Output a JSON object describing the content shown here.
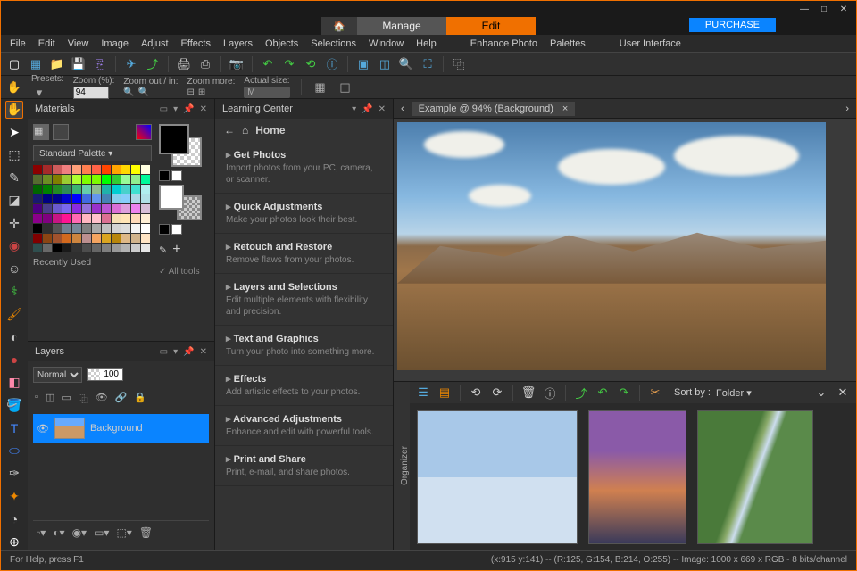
{
  "titlebar": {
    "min": "—",
    "max": "□",
    "close": "✕"
  },
  "topnav": {
    "home": "⌂",
    "manage": "Manage",
    "edit": "Edit",
    "purchase": "PURCHASE"
  },
  "menu": [
    "File",
    "Edit",
    "View",
    "Image",
    "Adjust",
    "Effects",
    "Layers",
    "Objects",
    "Selections",
    "Window",
    "Help",
    "Enhance Photo",
    "Palettes",
    "User Interface"
  ],
  "opt": {
    "presets": "Presets:",
    "zoom_lbl": "Zoom (%):",
    "zoom_val": "94",
    "zoomio": "Zoom out / in:",
    "zoommore": "Zoom more:",
    "actual": "Actual size:"
  },
  "materials": {
    "title": "Materials",
    "palette": "Standard Palette  ▾",
    "recent": "Recently Used",
    "alltools": "✓   All tools"
  },
  "layers": {
    "title": "Layers",
    "blend": "Normal",
    "opacity": "100",
    "item": "Background"
  },
  "lc": {
    "title": "Learning Center",
    "home": "Home",
    "items": [
      {
        "t": "Get Photos",
        "d": "Import photos from your PC, camera, or scanner."
      },
      {
        "t": "Quick Adjustments",
        "d": "Make your photos look their best."
      },
      {
        "t": "Retouch and Restore",
        "d": "Remove flaws from your photos."
      },
      {
        "t": "Layers and Selections",
        "d": "Edit multiple elements with flexibility and precision."
      },
      {
        "t": "Text and Graphics",
        "d": "Turn your photo into something more."
      },
      {
        "t": "Effects",
        "d": "Add artistic effects to your photos."
      },
      {
        "t": "Advanced Adjustments",
        "d": "Enhance and edit with powerful tools."
      },
      {
        "t": "Print and Share",
        "d": "Print, e-mail, and share photos."
      }
    ]
  },
  "doc": {
    "tab": "Example @  94% (Background)",
    "close": "×"
  },
  "org": {
    "label": "Organizer",
    "sortby": "Sort by :",
    "folder": "Folder  ▾"
  },
  "status": {
    "left": "For Help, press F1",
    "right": "(x:915 y:141) -- (R:125, G:154, B:214, O:255)  --  Image:   1000 x 669 x RGB  -  8 bits/channel"
  },
  "palette_colors": [
    "#8b0000",
    "#a52a2a",
    "#cd5c5c",
    "#f08080",
    "#ffa07a",
    "#ff7f50",
    "#ff6347",
    "#ff4500",
    "#ffa500",
    "#ffd700",
    "#ffff00",
    "#ffffe0",
    "#556b2f",
    "#6b8e23",
    "#808000",
    "#9acd32",
    "#adff2f",
    "#7fff00",
    "#7cfc00",
    "#00ff00",
    "#32cd32",
    "#98fb98",
    "#90ee90",
    "#00fa9a",
    "#006400",
    "#008000",
    "#228b22",
    "#2e8b57",
    "#3cb371",
    "#66cdaa",
    "#8fbc8f",
    "#20b2aa",
    "#00ced1",
    "#48d1cc",
    "#40e0d0",
    "#afeeee",
    "#191970",
    "#000080",
    "#00008b",
    "#0000cd",
    "#0000ff",
    "#4169e1",
    "#6495ed",
    "#4682b4",
    "#87ceeb",
    "#87cefa",
    "#add8e6",
    "#b0e0e6",
    "#4b0082",
    "#483d8b",
    "#6a5acd",
    "#7b68ee",
    "#8a2be2",
    "#9370db",
    "#9932cc",
    "#ba55d3",
    "#da70d6",
    "#dda0dd",
    "#ee82ee",
    "#d8bfd8",
    "#8b008b",
    "#800080",
    "#c71585",
    "#ff1493",
    "#ff69b4",
    "#ffb6c1",
    "#ffc0cb",
    "#db7093",
    "#f5deb3",
    "#ffe4b5",
    "#ffdab9",
    "#ffefd5",
    "#000000",
    "#2f2f2f",
    "#555555",
    "#708090",
    "#778899",
    "#808080",
    "#a9a9a9",
    "#c0c0c0",
    "#d3d3d3",
    "#dcdcdc",
    "#f5f5f5",
    "#ffffff",
    "#800000",
    "#8b4513",
    "#a0522d",
    "#d2691e",
    "#cd853f",
    "#bc8f8f",
    "#f4a460",
    "#daa520",
    "#b8860b",
    "#deb887",
    "#d2b48c",
    "#ffe4c4",
    "#2f4f4f",
    "#696969",
    "#000000",
    "#1a1a1a",
    "#333333",
    "#4d4d4d",
    "#666666",
    "#7f7f7f",
    "#999999",
    "#b3b3b3",
    "#cccccc",
    "#e6e6e6"
  ]
}
